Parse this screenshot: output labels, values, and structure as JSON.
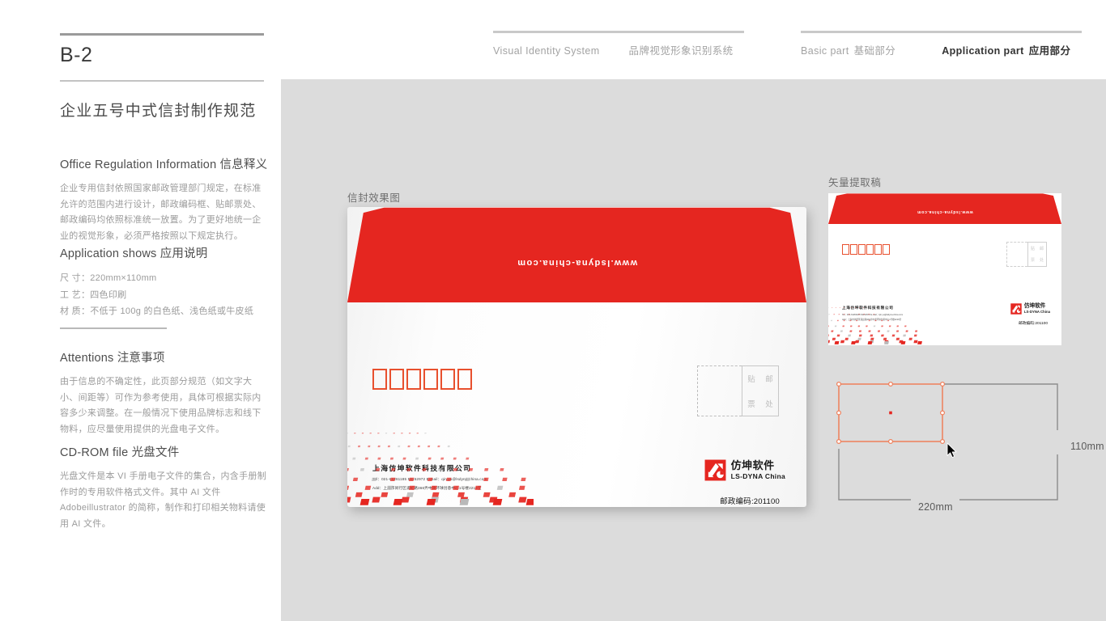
{
  "left": {
    "page_code": "B-2",
    "page_title": "企业五号中式信封制作规范",
    "sections": [
      {
        "heading": "Office Regulation Information 信息释义",
        "body": "企业专用信封依照国家邮政管理部门规定，在标准允许的范围内进行设计，邮政编码框、贴邮票处、邮政编码均依照标准统一放置。为了更好地统一企业的视觉形象，必须严格按照以下规定执行。"
      },
      {
        "heading": "Application shows 应用说明",
        "spec_size": "尺 寸：220mm×110mm",
        "spec_craft": "工 艺：四色印刷",
        "spec_material": "材 质：不低于 100g 的白色纸、浅色纸或牛皮纸"
      },
      {
        "heading": "Attentions 注意事项",
        "body": "由于信息的不确定性，此页部分规范（如文字大小、间距等）可作为参考使用，具体可根据实际内容多少来调整。在一般情况下使用品牌标志和线下物料，应尽量使用提供的光盘电子文件。"
      },
      {
        "heading": "CD-ROM file 光盘文件",
        "body": "光盘文件是本 VI 手册电子文件的集合，内含手册制作时的专用软件格式文件。其中 AI 文件 Adobeillustrator 的简称，制作和打印相关物料请使用 AI 文件。"
      }
    ]
  },
  "nav": {
    "group_a": [
      {
        "en": "Visual Identity System",
        "cn": ""
      },
      {
        "en": "",
        "cn": "品牌视觉形象识别系统"
      }
    ],
    "group_b": [
      {
        "en": "Basic part",
        "cn": "基础部分"
      },
      {
        "en": "Application part",
        "cn": "应用部分"
      }
    ]
  },
  "stage": {
    "label_mockup": "信封效果图",
    "label_vector": "矢量提取稿"
  },
  "envelope": {
    "url": "www.lsdyna-china.com",
    "postal_box_count": 6,
    "stamp_chars": [
      "贴",
      "邮",
      "票",
      "处"
    ],
    "company_name": "上海仿坤软件科技有限公司",
    "company_tel": "Tel：021-61261185   54152972   E-mail：qin.yu@lsdyna-china.com",
    "company_add": "Add：上海市闵行区浦虹路366弄中庚环球创意中心1号楼2219室",
    "logo_cn": "仿坤软件",
    "logo_en": "LS-DYNA China",
    "zip_label": "邮政编码:201100"
  },
  "tech": {
    "height_label": "110mm",
    "width_label": "220mm"
  },
  "colors": {
    "brand_red": "#e52620",
    "postal_box_red": "#e8502e",
    "stage_bg": "#dcdcdc",
    "selection_orange": "#ef7f5a"
  }
}
